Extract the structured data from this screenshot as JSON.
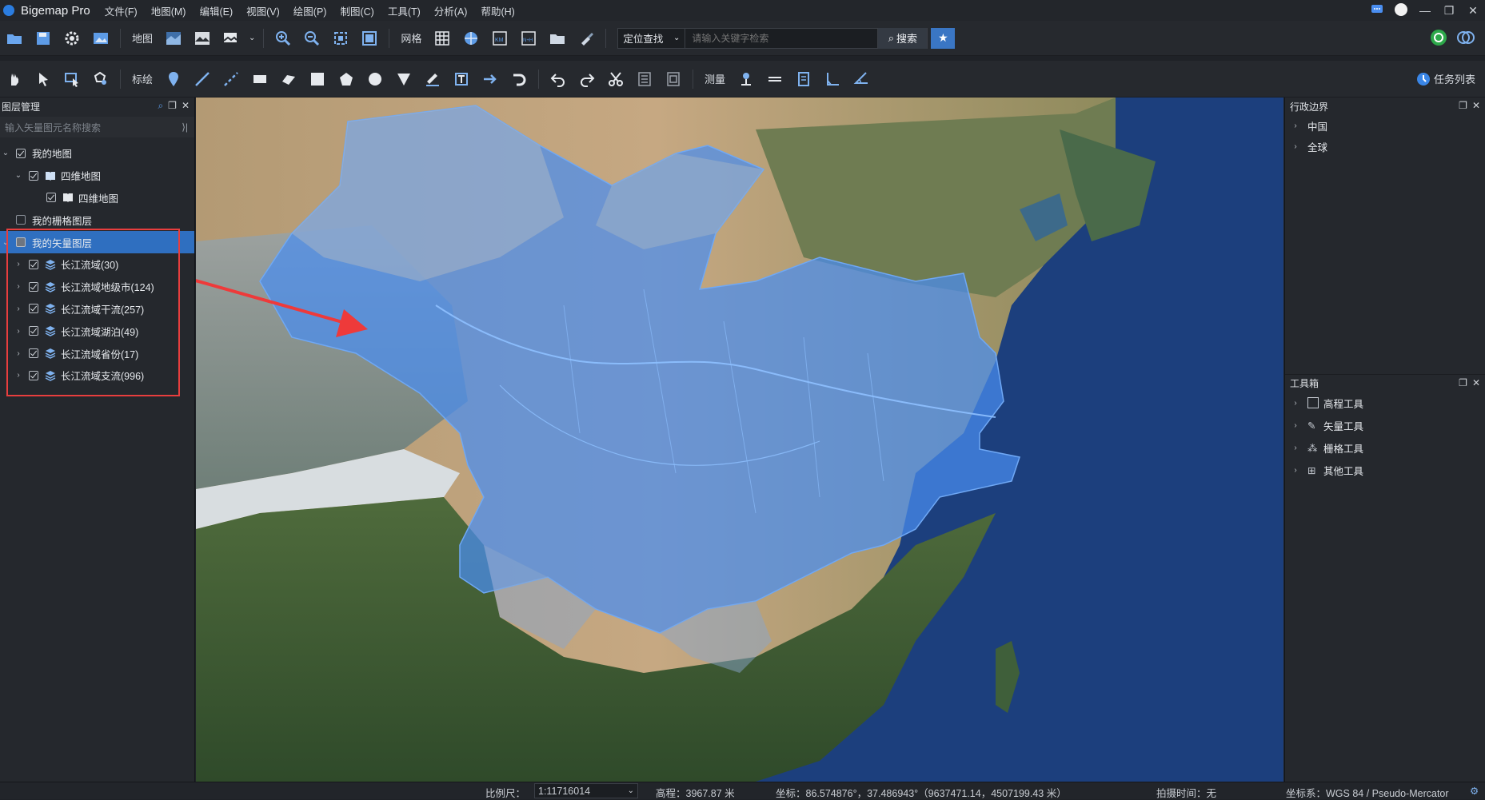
{
  "app": {
    "title": "Bigemap Pro"
  },
  "menu": [
    "文件(F)",
    "地图(M)",
    "编辑(E)",
    "视图(V)",
    "绘图(P)",
    "制图(C)",
    "工具(T)",
    "分析(A)",
    "帮助(H)"
  ],
  "toolbar1": {
    "map_label": "地图",
    "grid_label": "网格",
    "search_mode": "定位查找",
    "search_placeholder": "请输入关键字检索",
    "search_button": "搜索"
  },
  "toolbar2": {
    "annotate_label": "标绘",
    "measure_label": "测量",
    "tasks_label": "任务列表"
  },
  "left_panel": {
    "title": "图层管理",
    "filter_placeholder": "输入矢量图元名称搜索",
    "tree": [
      {
        "label": "我的地图"
      },
      {
        "label": "四维地图"
      },
      {
        "label": "四维地图"
      },
      {
        "label": "我的栅格图层"
      },
      {
        "label": "我的矢量图层"
      },
      {
        "label": "长江流域(30)"
      },
      {
        "label": "长江流域地级市(124)"
      },
      {
        "label": "长江流域干流(257)"
      },
      {
        "label": "长江流域湖泊(49)"
      },
      {
        "label": "长江流域省份(17)"
      },
      {
        "label": "长江流域支流(996)"
      }
    ]
  },
  "right_panel": {
    "admin_title": "行政边界",
    "admin_items": [
      "中国",
      "全球"
    ],
    "toolbox_title": "工具箱",
    "toolbox_items": [
      "高程工具",
      "矢量工具",
      "栅格工具",
      "其他工具"
    ]
  },
  "status": {
    "scale_label": "比例尺：",
    "scale_value": "1:11716014",
    "elevation": "高程：3967.87 米",
    "coords": "坐标：86.574876°，37.486943°（9637471.14，4507199.43 米）",
    "capture_time": "拍摄时间：无",
    "crs": "坐标系：WGS 84 / Pseudo-Mercator"
  },
  "colors": {
    "accent": "#2f6fc0",
    "highlight": "#e83e3e",
    "basin_fill": "#4a8ef0"
  }
}
